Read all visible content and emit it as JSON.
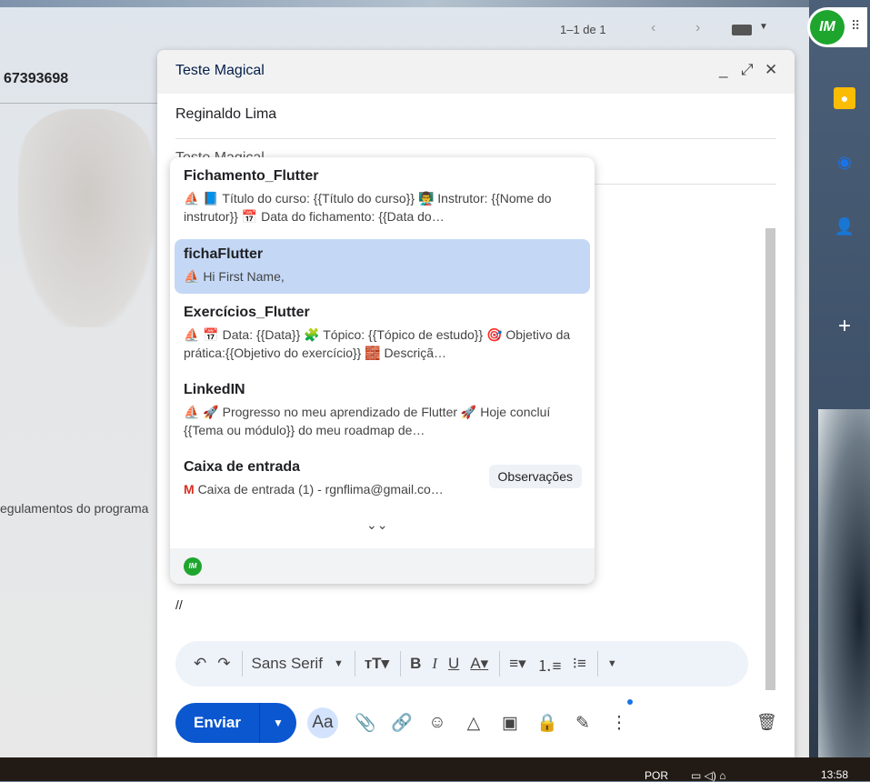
{
  "background": {
    "contact_number": "67393698",
    "snippet": "egulamentos do programa",
    "pager": "1–1 de 1"
  },
  "compose": {
    "title": "Teste Magical",
    "to": "Reginaldo Lima",
    "subject_partial": "Teste Magical",
    "body": "//",
    "toolbar": {
      "font": "Sans Serif"
    },
    "send_label": "Enviar",
    "format_label": "Aa"
  },
  "popup": {
    "items": [
      {
        "name": "Fichamento_Flutter",
        "preview": "⛵ 📘 Título do curso: {{Título do curso}} 👨‍🏫 Instrutor: {{Nome do instrutor}} 📅 Data do fichamento: {{Data do…"
      },
      {
        "name": "fichaFlutter",
        "preview": "⛵ Hi First Name,",
        "selected": true
      },
      {
        "name": "Exercícios_Flutter",
        "preview": "⛵ 📅 Data: {{Data}} 🧩 Tópico: {{Tópico de estudo}} 🎯 Objetivo da prática:{{Objetivo do exercício}} 🧱 Descriçã…"
      },
      {
        "name": "LinkedIN",
        "preview": "⛵ 🚀 Progresso no meu aprendizado de Flutter 🚀 Hoje concluí {{Tema ou módulo}} do meu roadmap de…"
      },
      {
        "name": "Caixa de entrada",
        "preview": "Caixa de entrada (1) - rgnflima@gmail.co…"
      }
    ],
    "tag": "Observações",
    "logo_text": "IM"
  },
  "sidebar": {
    "logo_text": "IM"
  },
  "taskbar": {
    "lang": "POR",
    "time": "13:58"
  }
}
